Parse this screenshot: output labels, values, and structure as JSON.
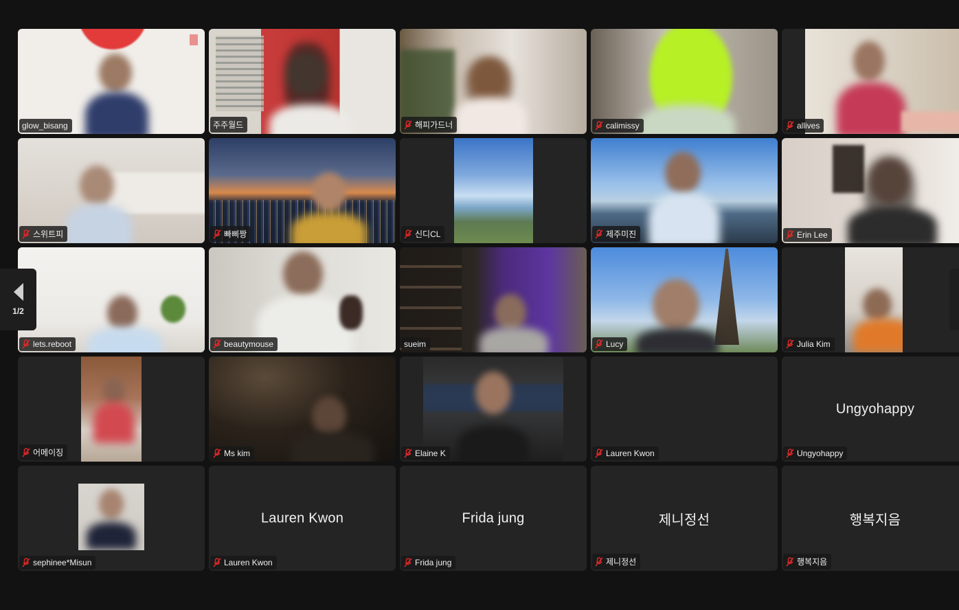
{
  "participants": [
    {
      "name": "glow_bisang",
      "muted": false
    },
    {
      "name": "주주월드",
      "muted": false,
      "active_speaker": true
    },
    {
      "name": "해피가드너",
      "muted": true
    },
    {
      "name": "calimissy",
      "muted": true
    },
    {
      "name": "allives",
      "muted": true
    },
    {
      "name": "스위트피",
      "muted": true
    },
    {
      "name": "빠삐짱",
      "muted": true
    },
    {
      "name": "신디CL",
      "muted": true
    },
    {
      "name": "제주미진",
      "muted": true
    },
    {
      "name": "Erin Lee",
      "muted": true
    },
    {
      "name": "lets.reboot",
      "muted": true
    },
    {
      "name": "beautymouse",
      "muted": true
    },
    {
      "name": "sueim",
      "muted": false
    },
    {
      "name": "Lucy",
      "muted": true
    },
    {
      "name": "Julia Kim",
      "muted": true
    },
    {
      "name": "어메이징",
      "muted": true
    },
    {
      "name": "Ms kim",
      "muted": true
    },
    {
      "name": "Elaine K",
      "muted": true
    },
    {
      "name": "Lauren Kwon",
      "muted": true,
      "video_off": true,
      "center_label": ""
    },
    {
      "name": "Ungyohappy",
      "muted": true,
      "video_off": true,
      "center_label": "Ungyohappy"
    },
    {
      "name": "sephinee*Misun",
      "muted": true
    },
    {
      "name": "Lauren Kwon",
      "muted": true,
      "video_off": true,
      "center_label": "Lauren Kwon"
    },
    {
      "name": "Frida jung",
      "muted": true,
      "video_off": true,
      "center_label": "Frida jung"
    },
    {
      "name": "제니정선",
      "muted": true,
      "video_off": true,
      "center_label": "제니정선"
    },
    {
      "name": "행복지음",
      "muted": true,
      "video_off": true,
      "center_label": "행복지음"
    }
  ],
  "pagination": {
    "label": "1/2"
  },
  "colors": {
    "active_speaker_border": "#23d959",
    "muted_mic": "#e02828"
  }
}
